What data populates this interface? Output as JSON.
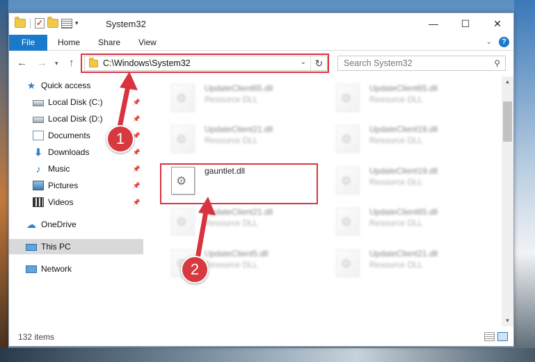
{
  "window": {
    "title": "System32",
    "controls": [
      "—",
      "☐",
      "✕"
    ]
  },
  "ribbon": {
    "file_tab": "File",
    "tabs": [
      "Home",
      "Share",
      "View"
    ]
  },
  "address": {
    "path": "C:\\Windows\\System32",
    "search_placeholder": "Search System32"
  },
  "sidebar": {
    "items": [
      {
        "label": "Quick access",
        "icon": "star-icon"
      },
      {
        "label": "Local Disk (C:)",
        "icon": "disk-icon",
        "pinned": true
      },
      {
        "label": "Local Disk (D:)",
        "icon": "disk-icon",
        "pinned": true
      },
      {
        "label": "Documents",
        "icon": "documents-icon",
        "pinned": true
      },
      {
        "label": "Downloads",
        "icon": "download-icon",
        "pinned": true
      },
      {
        "label": "Music",
        "icon": "music-icon",
        "pinned": true
      },
      {
        "label": "Pictures",
        "icon": "pictures-icon",
        "pinned": true
      },
      {
        "label": "Videos",
        "icon": "videos-icon",
        "pinned": true
      },
      {
        "label": "OneDrive",
        "icon": "cloud-icon"
      },
      {
        "label": "This PC",
        "icon": "pc-icon",
        "selected": true
      },
      {
        "label": "Network",
        "icon": "network-icon"
      }
    ]
  },
  "files": [
    {
      "name": "UpdateClient65.dll",
      "type": "Resource DLL"
    },
    {
      "name": "UpdateClient65.dll",
      "type": "Resource DLL"
    },
    {
      "name": "UpdateClient21.dll",
      "type": "Resource DLL"
    },
    {
      "name": "UpdateClient19.dll",
      "type": "Resource DLL"
    },
    {
      "name": "gauntlet.dll",
      "type": ""
    },
    {
      "name": "UpdateClient19.dll",
      "type": "Resource DLL"
    },
    {
      "name": "UpdateClient21.dll",
      "type": "Resource DLL"
    },
    {
      "name": "UpdateClient65.dll",
      "type": "Resource DLL"
    },
    {
      "name": "UpdateClient5.dll",
      "type": "Resource DLL"
    },
    {
      "name": "UpdateClient21.dll",
      "type": "Resource DLL"
    }
  ],
  "status": {
    "item_count": "132 items"
  },
  "annotations": {
    "step1": "1",
    "step2": "2",
    "color": "#d9333f"
  }
}
